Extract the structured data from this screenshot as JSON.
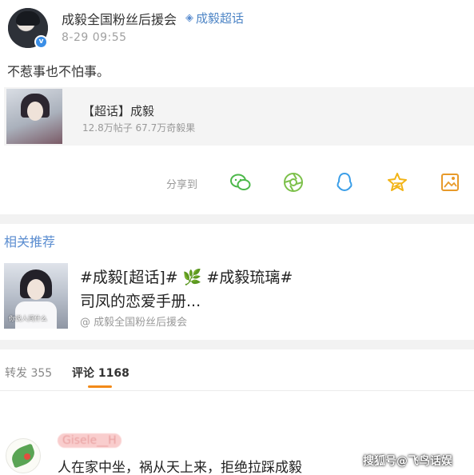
{
  "post": {
    "author": "成毅全国粉丝后援会",
    "topic_tag": "成毅超话",
    "time": "8-29 09:55",
    "text": "不惹事也不怕事。"
  },
  "super_topic_card": {
    "title": "【超话】成毅",
    "stats": "12.8万帖子 67.7万奇毅果"
  },
  "share": {
    "label": "分享到",
    "targets": [
      "wechat-icon",
      "moments-icon",
      "qq-icon",
      "qzone-icon",
      "save-image-icon"
    ]
  },
  "recommend": {
    "heading": "相关推荐",
    "title_line1": "#成毅[超话]# 🌿 #成毅琉璃#",
    "title_line2": "司凤的恋爱手册...",
    "source": "@ 成毅全国粉丝后援会",
    "thumb_caption": "你说人间什么"
  },
  "tabs": {
    "repost": "转发 355",
    "comment": "评论 1168"
  },
  "comment": {
    "username": "Gisele__H",
    "text": "人在家中坐，祸从天上来，拒绝拉踩成毅"
  },
  "watermark": "搜狐号@飞鸟话娱",
  "colors": {
    "link_blue": "#5b8dd0",
    "tab_accent": "#f28a18",
    "divider": "#f2f2f2"
  }
}
